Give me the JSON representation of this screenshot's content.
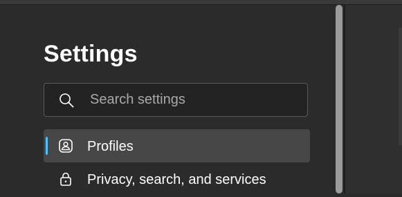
{
  "settings": {
    "title": "Settings"
  },
  "search": {
    "placeholder": "Search settings",
    "icon": "search-icon"
  },
  "nav": {
    "items": [
      {
        "label": "Profiles",
        "icon": "profile-icon",
        "selected": true
      },
      {
        "label": "Privacy, search, and services",
        "icon": "lock-icon",
        "selected": false
      }
    ]
  },
  "colors": {
    "background": "#2b2b2b",
    "selected_bg": "#474747",
    "accent": "#4cc2ff",
    "text": "#ffffff",
    "placeholder": "#a9a9a9"
  }
}
